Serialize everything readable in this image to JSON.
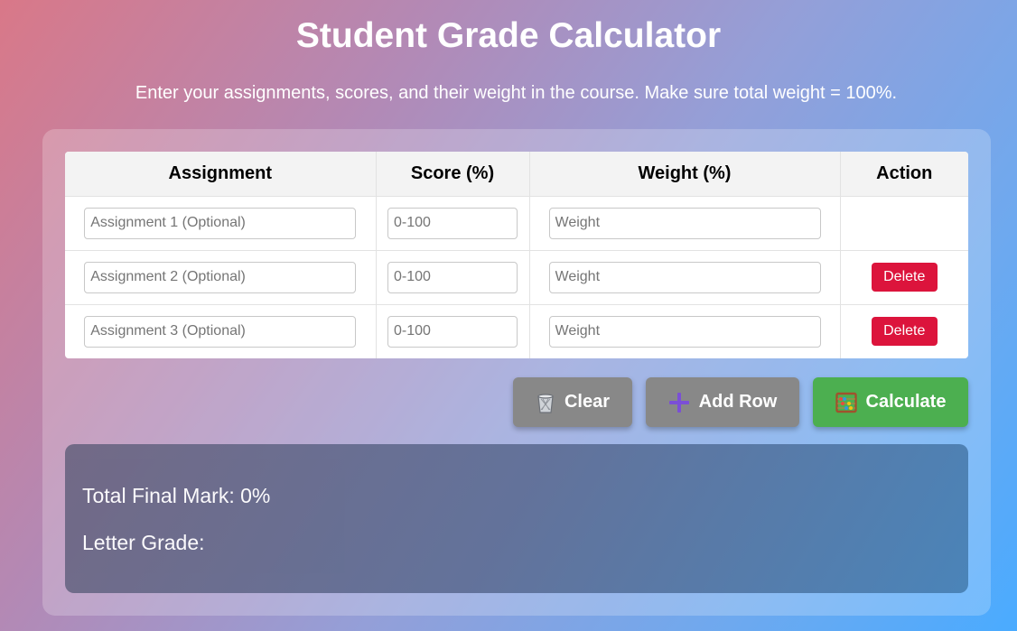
{
  "header": {
    "title": "Student Grade Calculator",
    "subtitle": "Enter your assignments, scores, and their weight in the course. Make sure total weight = 100%."
  },
  "table": {
    "columns": [
      "Assignment",
      "Score (%)",
      "Weight (%)",
      "Action"
    ],
    "rows": [
      {
        "assignment_placeholder": "Assignment 1 (Optional)",
        "score_placeholder": "0-100",
        "weight_placeholder": "Weight",
        "action": ""
      },
      {
        "assignment_placeholder": "Assignment 2 (Optional)",
        "score_placeholder": "0-100",
        "weight_placeholder": "Weight",
        "action": "Delete"
      },
      {
        "assignment_placeholder": "Assignment 3 (Optional)",
        "score_placeholder": "0-100",
        "weight_placeholder": "Weight",
        "action": "Delete"
      }
    ]
  },
  "actions": {
    "clear": {
      "label": "Clear",
      "icon": "wastebasket-icon"
    },
    "add_row": {
      "label": "Add Row",
      "icon": "plus-icon"
    },
    "calculate": {
      "label": "Calculate",
      "icon": "abacus-icon"
    }
  },
  "result": {
    "total_label": "Total Final Mark: 0%",
    "letter_label": "Letter Grade:"
  },
  "colors": {
    "delete": "#dc143c",
    "calculate": "#4caf50",
    "neutral_button": "#888888"
  }
}
